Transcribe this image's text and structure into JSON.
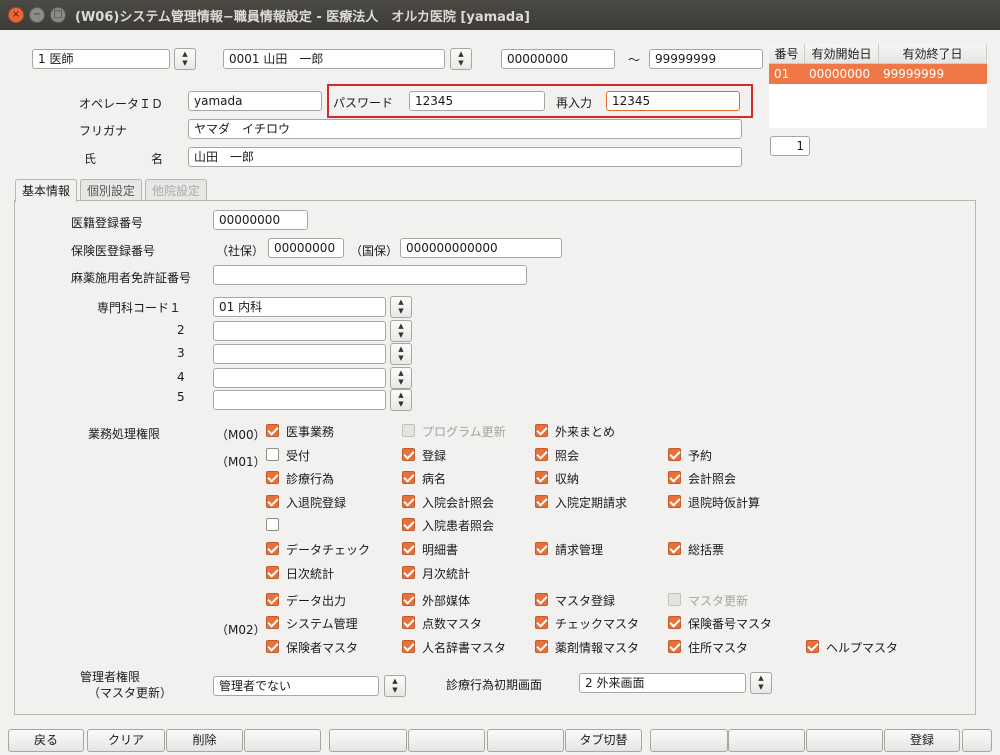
{
  "window": {
    "title": "(W06)システム管理情報−職員情報設定 - 医療法人　オルカ医院 [yamada]",
    "close_glyph": "×",
    "min_glyph": "−",
    "max_glyph": "□"
  },
  "header": {
    "job_type": "1 医師",
    "staff": "0001 山田　一郎",
    "range_from": "00000000",
    "range_sep": "〜",
    "range_to": "99999999",
    "operator_id_label": "オペレータＩＤ",
    "operator_id": "yamada",
    "password_label": "パスワード",
    "password": "12345",
    "reenter_label": "再入力",
    "reenter": "12345",
    "furigana_label": "フリガナ",
    "furigana": "ヤマダ　イチロウ",
    "name_label_1": "氏",
    "name_label_2": "名",
    "name": "山田　一郎"
  },
  "history_table": {
    "headers": [
      "番号",
      "有効開始日",
      "有効終了日"
    ],
    "rows": [
      [
        "01",
        "00000000",
        "99999999"
      ]
    ],
    "count": "1"
  },
  "tabs": [
    {
      "label": "基本情報",
      "state": "active"
    },
    {
      "label": "個別設定",
      "state": "normal"
    },
    {
      "label": "他院設定",
      "state": "disabled"
    }
  ],
  "basic": {
    "med_reg_label": "医籍登録番号",
    "med_reg": "00000000",
    "ins_reg_label": "保険医登録番号",
    "shaho_label": "（社保）",
    "shaho": "00000000",
    "kokuho_label": "（国保）",
    "kokuho": "000000000000",
    "narcotic_label": "麻薬施用者免許証番号",
    "narcotic": "",
    "specialty_label": "専門科コード１",
    "specialty": [
      {
        "num": "",
        "value": "01 内科"
      },
      {
        "num": "2",
        "value": ""
      },
      {
        "num": "3",
        "value": ""
      },
      {
        "num": "4",
        "value": ""
      },
      {
        "num": "5",
        "value": ""
      }
    ]
  },
  "permissions": {
    "label": "業務処理権限",
    "group_m00": "（M00）",
    "group_m01": "（M01）",
    "group_m02": "（M02）",
    "items": [
      {
        "label": "医事業務",
        "state": "on"
      },
      {
        "label": "プログラム更新",
        "state": "disabled"
      },
      {
        "label": "外来まとめ",
        "state": "on"
      },
      {
        "label": "受付",
        "state": "off"
      },
      {
        "label": "登録",
        "state": "on"
      },
      {
        "label": "照会",
        "state": "on"
      },
      {
        "label": "予約",
        "state": "on"
      },
      {
        "label": "診療行為",
        "state": "on"
      },
      {
        "label": "病名",
        "state": "on"
      },
      {
        "label": "収納",
        "state": "on"
      },
      {
        "label": "会計照会",
        "state": "on"
      },
      {
        "label": "入退院登録",
        "state": "on"
      },
      {
        "label": "入院会計照会",
        "state": "on"
      },
      {
        "label": "入院定期請求",
        "state": "on"
      },
      {
        "label": "退院時仮計算",
        "state": "on"
      },
      {
        "label": "",
        "state": "off"
      },
      {
        "label": "入院患者照会",
        "state": "on"
      },
      {
        "label": "データチェック",
        "state": "on"
      },
      {
        "label": "明細書",
        "state": "on"
      },
      {
        "label": "請求管理",
        "state": "on"
      },
      {
        "label": "総括票",
        "state": "on"
      },
      {
        "label": "日次統計",
        "state": "on"
      },
      {
        "label": "月次統計",
        "state": "on"
      },
      {
        "label": "データ出力",
        "state": "on"
      },
      {
        "label": "外部媒体",
        "state": "on"
      },
      {
        "label": "マスタ登録",
        "state": "on"
      },
      {
        "label": "マスタ更新",
        "state": "disabled"
      },
      {
        "label": "システム管理",
        "state": "on"
      },
      {
        "label": "点数マスタ",
        "state": "on"
      },
      {
        "label": "チェックマスタ",
        "state": "on"
      },
      {
        "label": "保険番号マスタ",
        "state": "on"
      },
      {
        "label": "保険者マスタ",
        "state": "on"
      },
      {
        "label": "人名辞書マスタ",
        "state": "on"
      },
      {
        "label": "薬剤情報マスタ",
        "state": "on"
      },
      {
        "label": "住所マスタ",
        "state": "on"
      },
      {
        "label": "ヘルプマスタ",
        "state": "on"
      }
    ]
  },
  "admin": {
    "label_1": "管理者権限",
    "label_2": "（マスタ更新）",
    "value": "管理者でない",
    "initial_screen_label": "診療行為初期画面",
    "initial_screen": "2 外来画面"
  },
  "footer": {
    "buttons": [
      "戻る",
      "クリア",
      "削除",
      "",
      "",
      "",
      "",
      "タブ切替",
      "",
      "",
      "",
      "登録",
      ""
    ]
  },
  "colors": {
    "accent": "#f07746",
    "highlight_box": "#d42a2a",
    "titlebar": "#3c3b37"
  }
}
